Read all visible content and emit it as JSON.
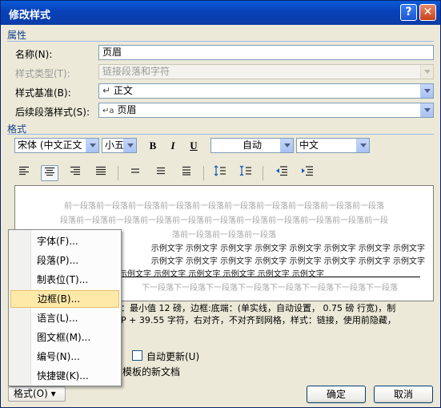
{
  "window": {
    "title": "修改样式",
    "help_btn": "?",
    "close_btn": "✕"
  },
  "properties": {
    "section": "属性",
    "name_label": "名称(N):",
    "name_value": "页眉",
    "type_label": "样式类型(T):",
    "type_value": "链接段落和字符",
    "based_label": "样式基准(B):",
    "based_value": "正文",
    "based_icon": "↵",
    "next_label": "后续段落样式(S):",
    "next_value": "页眉",
    "next_icon": "↵a"
  },
  "format": {
    "section": "格式",
    "font": "宋体 (中文正文",
    "size": "小五",
    "bold": "B",
    "italic": "I",
    "underline": "U",
    "color": "自动",
    "lang": "中文"
  },
  "preview": {
    "prev_line_1": "前一段落前一段落前一段落前一段落前一段落前一段落前一段落前一段落前一段落前一段落",
    "prev_line_2": "段落前一段落前一段落前一段落前一段落前一段落前一段落前一段落前一段落前一段落前一段",
    "prev_line_3": "落前一段落前一段落前一段落",
    "sample_1": "示例文字 示例文字 示例文字 示例文字 示例文字 示例文字 示例文字 示例文字",
    "sample_2": "示例文字 示例文字 示例文字 示例文字 示例文字 示例文字 示例文字 示例文字",
    "sample_3": "示例文字 示例文字 示例文字 示例文字 示例文字 示例文字",
    "next_line_1": "下一段落下一段落下一段落下一段落下一段落下一段落下一段落下一段落"
  },
  "description": {
    "line1": "：最小值 12 磅，边框:底端：(单实线，自动设置，  0.75 磅 行宽)，制",
    "line2": "P  +  39.55 字符，右对齐，不对齐到网格，样式：链接，使用前隐藏，"
  },
  "options": {
    "auto_update": "自动更新(U)",
    "template_new_docs": "模板的新文档"
  },
  "buttons": {
    "ok": "确定",
    "cancel": "取消",
    "format": "格式(O) ▾"
  },
  "menu": {
    "items": [
      "字体(F)...",
      "段落(P)...",
      "制表位(T)...",
      "边框(B)...",
      "语言(L)...",
      "图文框(M)...",
      "编号(N)...",
      "快捷键(K)..."
    ],
    "highlighted_index": 3
  }
}
